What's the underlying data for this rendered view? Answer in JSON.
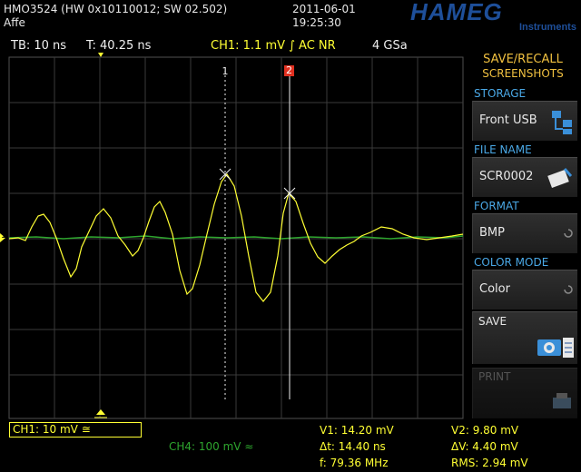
{
  "header": {
    "model": "HMO3524 (HW 0x10110012; SW 02.502)",
    "name": "Affe",
    "date": "2011-06-01",
    "time": "19:25:30",
    "brand": "HAMEG",
    "brand_sub": "Instruments"
  },
  "status": {
    "timebase": "TB: 10 ns",
    "trigger_time": "T: 40.25 ns",
    "ch1_setting": "CH1: 1.1 mV ∫ AC NR",
    "sample_rate": "4 GSa"
  },
  "screen": {
    "cursor1_label": "1",
    "cursor2_label": "2",
    "ground_marker": "1"
  },
  "sidebar": {
    "title_line1": "SAVE/RECALL",
    "title_line2": "SCREENSHOTS",
    "storage_label": "STORAGE",
    "storage_value": "Front USB",
    "file_name_label": "FILE NAME",
    "file_name_value": "SCR0002",
    "format_label": "FORMAT",
    "format_value": "BMP",
    "color_mode_label": "COLOR MODE",
    "color_mode_value": "Color",
    "save_label": "SAVE",
    "print_label": "PRINT"
  },
  "channels": {
    "ch1": "CH1: 10 mV ≅",
    "ch4": "CH4: 100 mV ≈"
  },
  "measurements": {
    "v1": "V1: 14.20 mV",
    "dt": "Δt: 14.40 ns",
    "f": "f: 79.36 MHz",
    "v2": "V2: 9.80 mV",
    "dv": "ΔV: 4.40 mV",
    "rms": "RMS: 2.94 mV"
  },
  "colors": {
    "ch1": "#ffff33",
    "ch4": "#2ea52e",
    "cursor2": "#e03020",
    "panel_label": "#4aa8e6",
    "brand": "#1e4f9a"
  }
}
